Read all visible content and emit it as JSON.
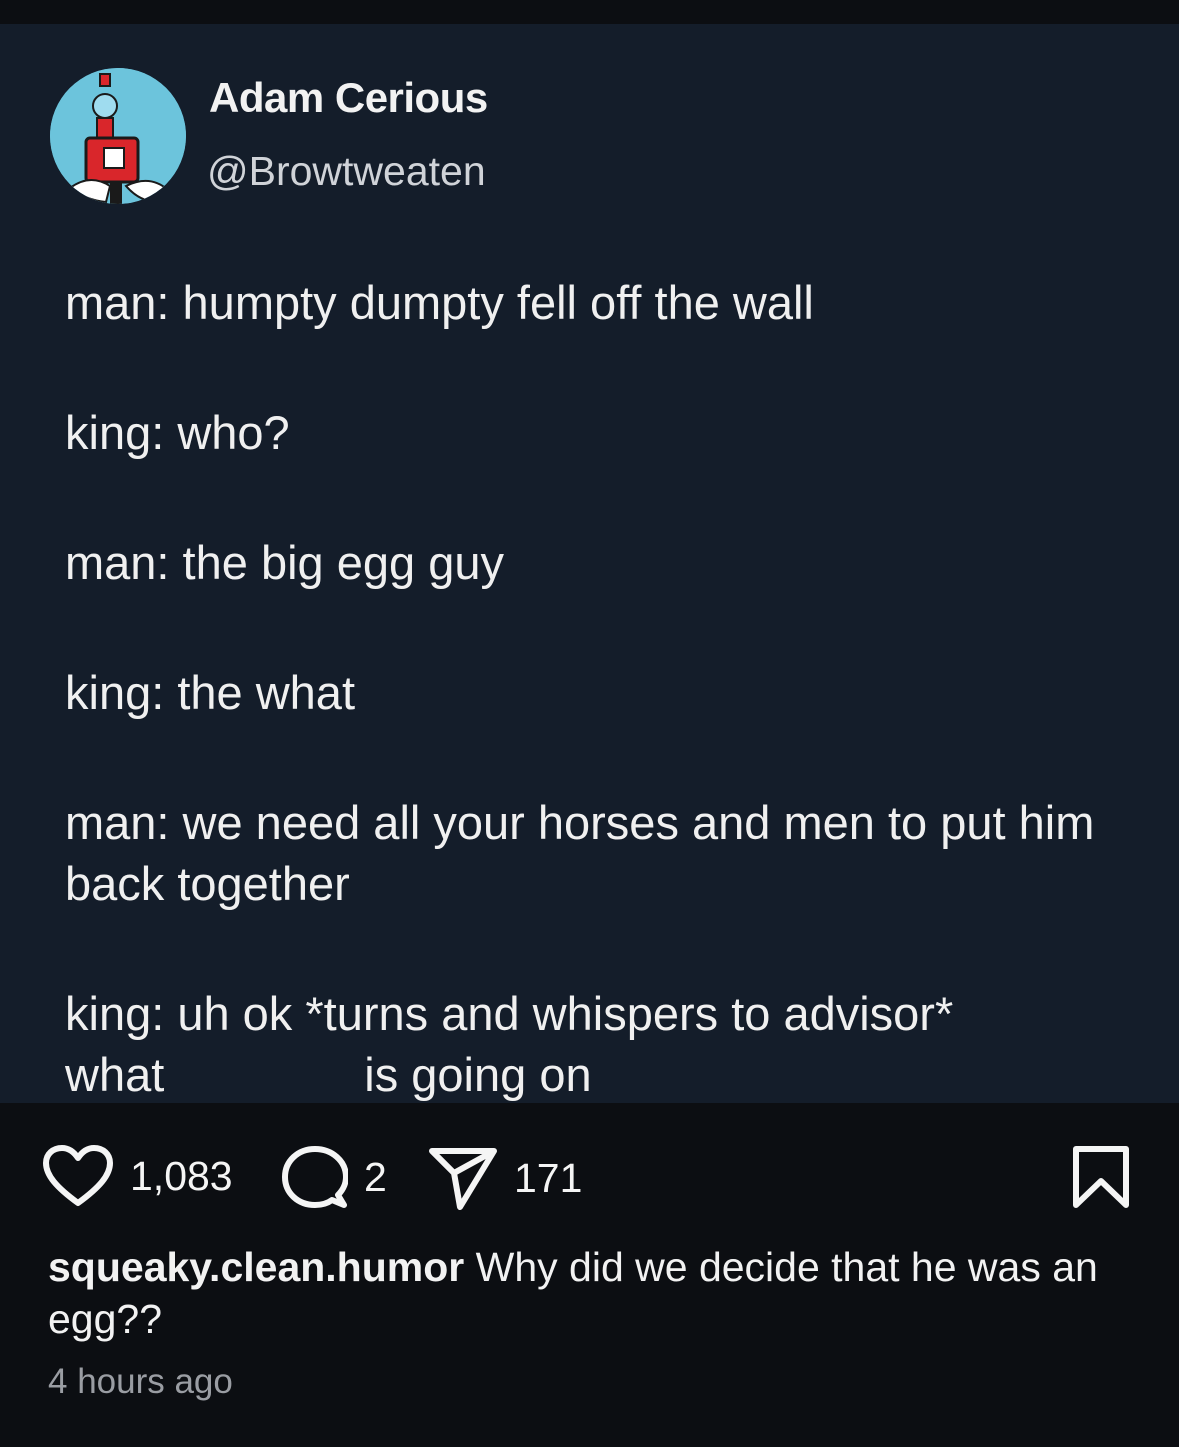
{
  "tweet": {
    "author_name": "Adam Cerious",
    "author_handle": "@Browtweaten",
    "avatar_icon": "robot-avatar-icon",
    "lines": [
      "man: humpty dumpty fell off the wall",
      "king: who?",
      "man: the big egg guy",
      "king: the what",
      "man: we need all your horses and men to put him back together"
    ],
    "last_line_part1": "king: uh ok *turns and whispers to advisor*",
    "last_line_part2_a": "what",
    "last_line_part2_b": "is going on"
  },
  "actions": {
    "likes": "1,083",
    "comments": "2",
    "shares": "171",
    "like_icon": "heart-icon",
    "comment_icon": "comment-icon",
    "share_icon": "send-icon",
    "save_icon": "bookmark-icon"
  },
  "caption": {
    "username": "squeaky.clean.humor",
    "text": "Why did we decide that he was an egg??"
  },
  "timestamp": "4 hours ago",
  "colors": {
    "page_bg": "#0c0e12",
    "tweet_bg": "#141d2a",
    "avatar_bg": "#6cc4dc",
    "robot_red": "#d9262b"
  }
}
